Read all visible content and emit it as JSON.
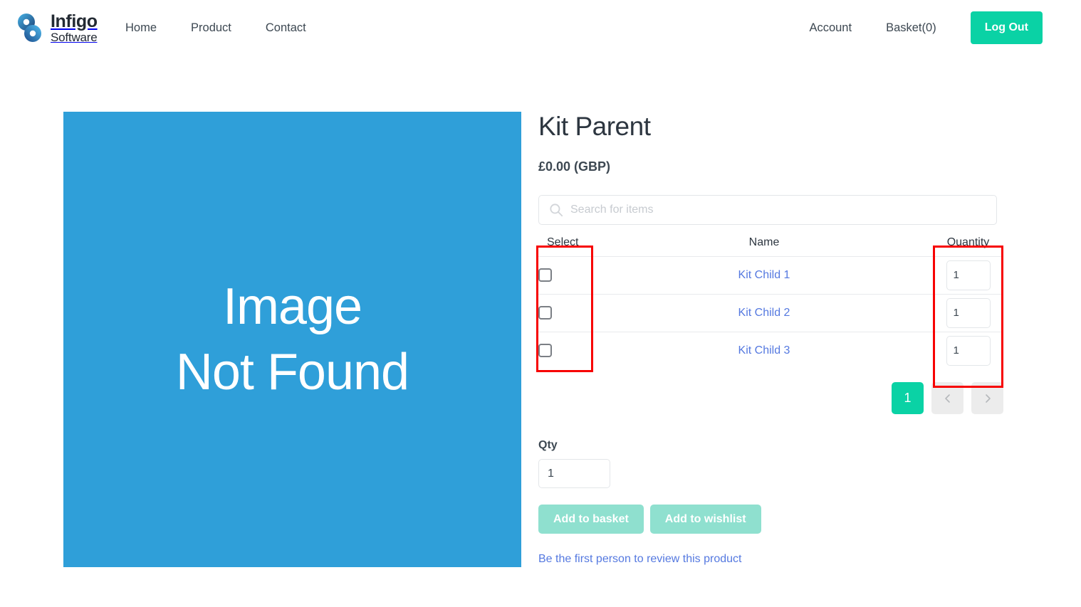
{
  "header": {
    "brand": {
      "name": "Infigo",
      "sub": "Software",
      "icon": "infinity-loop-logo-icon"
    },
    "nav_left": [
      {
        "label": "Home",
        "name": "nav-link-home"
      },
      {
        "label": "Product",
        "name": "nav-link-product"
      },
      {
        "label": "Contact",
        "name": "nav-link-contact"
      }
    ],
    "nav_right": [
      {
        "label": "Account",
        "name": "nav-link-account"
      },
      {
        "label": "Basket(0)",
        "name": "nav-link-basket"
      }
    ],
    "logout_label": "Log Out"
  },
  "product": {
    "image_placeholder_line1": "Image",
    "image_placeholder_line2": "Not Found",
    "image_bg_color": "#2f9fd9",
    "title": "Kit Parent",
    "price": "£0.00 (GBP)"
  },
  "search": {
    "placeholder": "Search for items",
    "value": "",
    "icon": "search-icon"
  },
  "items_table": {
    "columns": [
      "Select",
      "Name",
      "Quantity"
    ],
    "rows": [
      {
        "selected": false,
        "name": "Kit Child 1",
        "quantity": "1"
      },
      {
        "selected": false,
        "name": "Kit Child 2",
        "quantity": "1"
      },
      {
        "selected": false,
        "name": "Kit Child 3",
        "quantity": "1"
      }
    ]
  },
  "pagination": {
    "current_page": "1",
    "prev_icon": "chevron-left-icon",
    "next_icon": "chevron-right-icon"
  },
  "qty": {
    "label": "Qty",
    "value": "1"
  },
  "actions": {
    "add_to_basket": "Add to basket",
    "add_to_wishlist": "Add to wishlist"
  },
  "review": {
    "link_label": "Be the first person to review this product"
  },
  "annotations": {
    "select_column_highlight": "red-box",
    "quantity_column_highlight": "red-box",
    "color": "#f70000"
  },
  "colors": {
    "accent_teal": "#0ad2a5",
    "accent_teal_faded": "#8fe0cf",
    "link_blue": "#5579e0",
    "image_blue": "#2f9fd9",
    "annotation_red": "#f70000"
  }
}
